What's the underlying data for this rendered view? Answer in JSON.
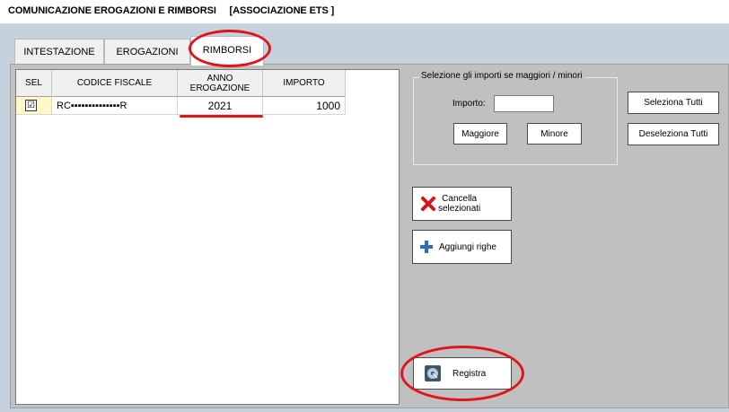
{
  "window": {
    "title": "COMUNICAZIONE EROGAZIONI E RIMBORSI     [ASSOCIAZIONE ETS ]"
  },
  "tabs": [
    {
      "label": "INTESTAZIONE",
      "active": false
    },
    {
      "label": "EROGAZIONI",
      "active": false
    },
    {
      "label": "RIMBORSI",
      "active": true
    }
  ],
  "grid": {
    "headers": {
      "sel": "SEL",
      "codice_fiscale": "CODICE FISCALE",
      "anno_line1": "ANNO",
      "anno_line2": "EROGAZIONE",
      "importo": "IMPORTO"
    },
    "rows": [
      {
        "sel_checked": true,
        "sel_mark": "☑",
        "codice_fiscale": "RC▪▪▪▪▪▪▪▪▪▪▪▪▪▪R",
        "anno": "2021",
        "importo": "1000"
      }
    ]
  },
  "selection": {
    "group_title": "Selezione gli importi se maggiori / minori",
    "importo_label": "Importo:",
    "importo_value": "",
    "maggiore": "Maggiore",
    "minore": "Minore",
    "seleziona_tutti": "Seleziona Tutti",
    "deseleziona_tutti": "Deseleziona Tutti"
  },
  "actions": {
    "cancella_line1": "Cancella",
    "cancella_line2": "selezionati",
    "aggiungi": "Aggiungi righe",
    "registra": "Registra"
  },
  "colors": {
    "annotation": "#e0141b",
    "cancel_icon": "#d4141a",
    "add_icon": "#2f6fb5"
  }
}
